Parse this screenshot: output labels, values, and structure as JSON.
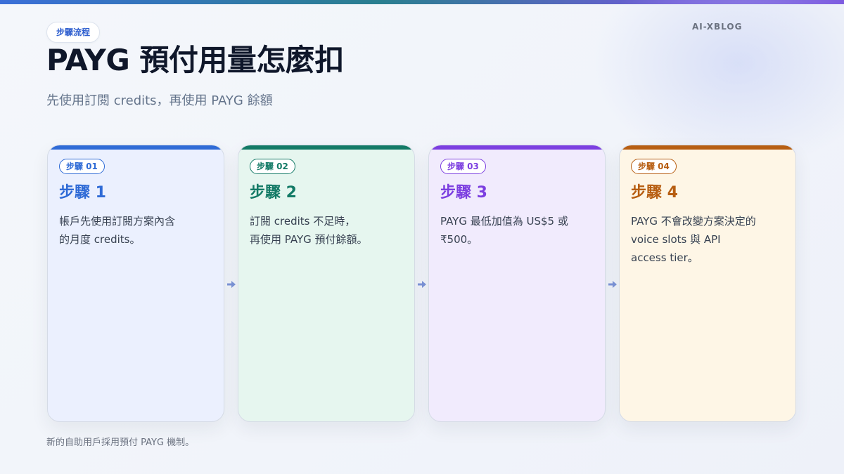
{
  "brand": "AI-XBLOG",
  "eyebrow": "步驟流程",
  "title": "PAYG 預付用量怎麼扣",
  "subtitle": "先使用訂閱 credits，再使用 PAYG 餘額",
  "footnote": "新的自助用戶採用預付 PAYG 機制。",
  "colors": {
    "step1": "#2f6bd6",
    "step2": "#137a66",
    "step3": "#7c3fe0",
    "step4": "#b75e12",
    "arrow": "#7b93d6"
  },
  "steps": [
    {
      "badge": "步驟 01",
      "title": "步驟 1",
      "desc": "帳戶先使用訂閱方案內含\n的月度 credits。"
    },
    {
      "badge": "步驟 02",
      "title": "步驟 2",
      "desc": "訂閱 credits 不足時，\n再使用 PAYG 預付餘額。"
    },
    {
      "badge": "步驟 03",
      "title": "步驟 3",
      "desc": "PAYG 最低加值為 US$5 或\n₹500。"
    },
    {
      "badge": "步驟 04",
      "title": "步驟 4",
      "desc": "PAYG 不會改變方案決定的\nvoice slots 與 API\naccess tier。"
    }
  ],
  "arrow_icon": "arrow-right-icon"
}
